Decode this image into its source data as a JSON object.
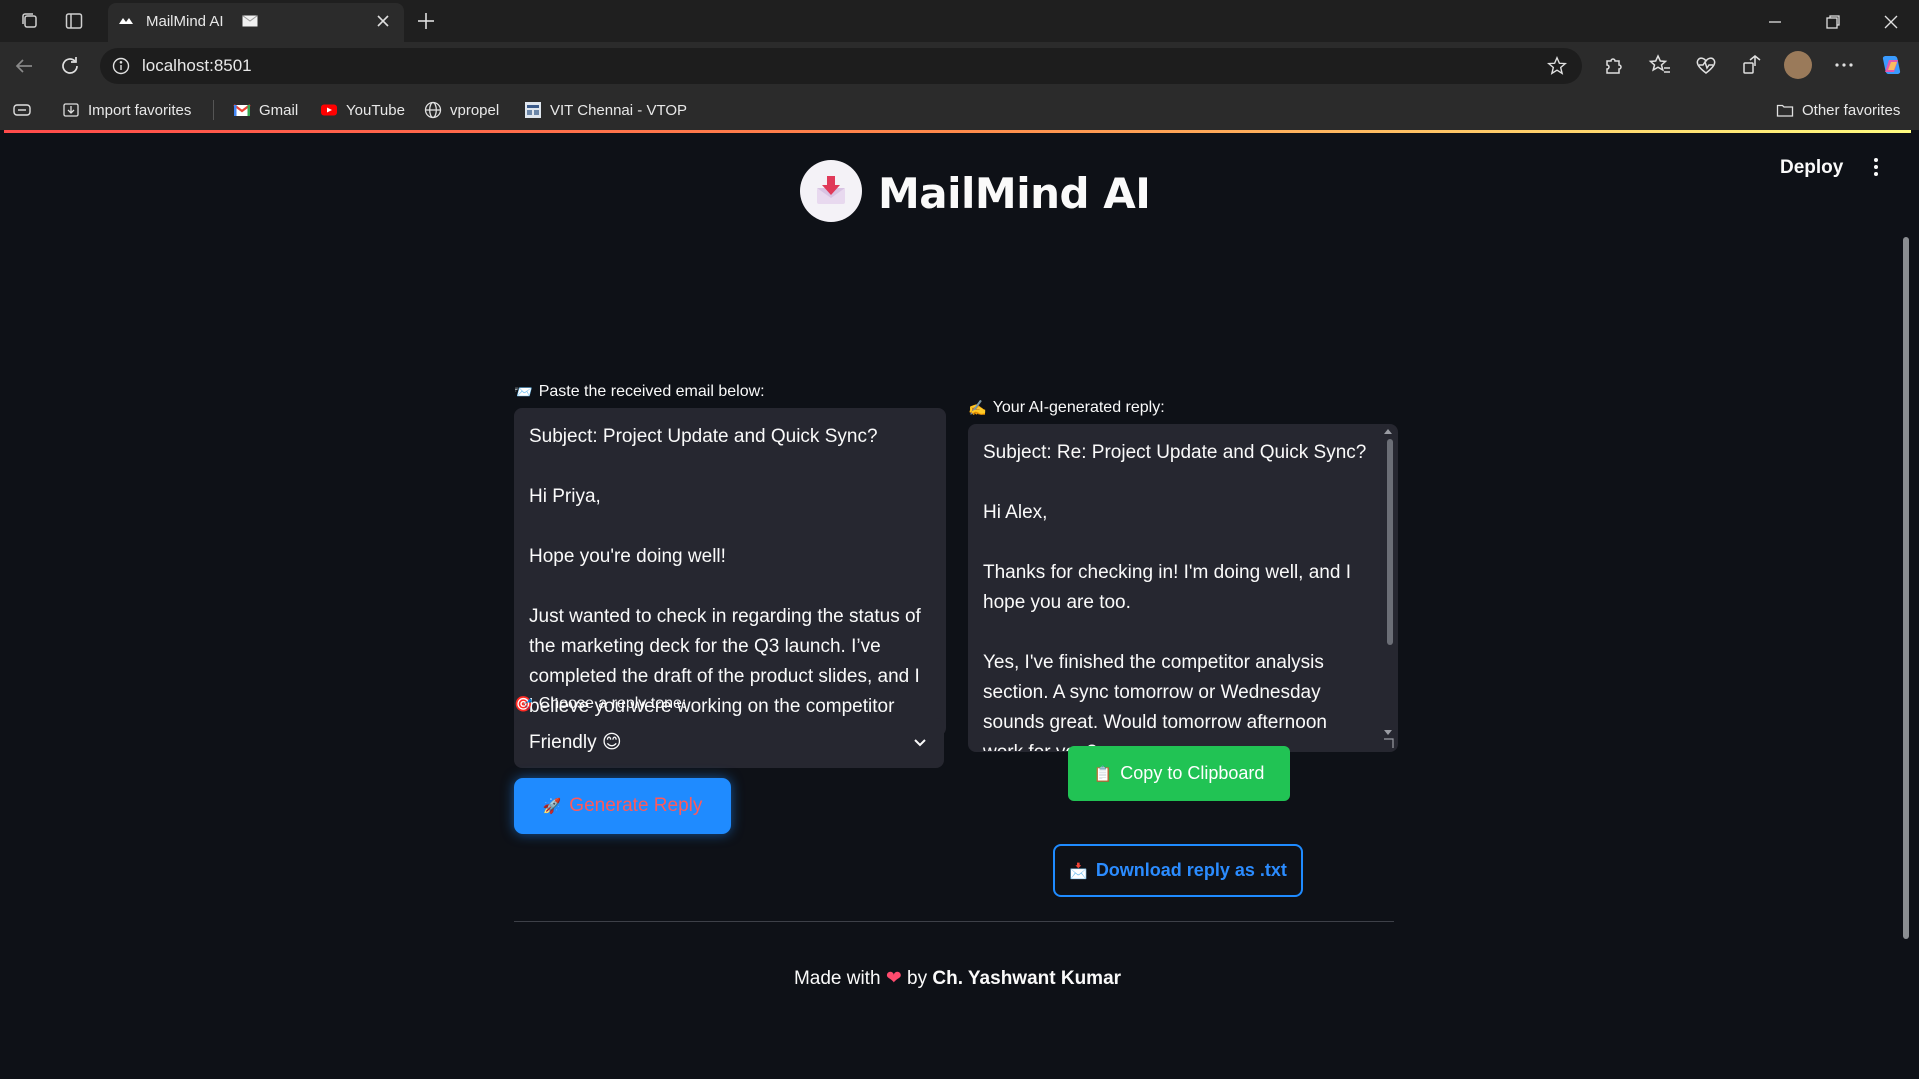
{
  "browser": {
    "tab_title": "MailMind AI",
    "url": "localhost:8501",
    "bookmarks": [
      {
        "label": "Import favorites",
        "icon": "import-icon"
      },
      {
        "label": "Gmail",
        "icon": "gmail-icon"
      },
      {
        "label": "YouTube",
        "icon": "youtube-icon"
      },
      {
        "label": "vpropel",
        "icon": "globe-icon"
      },
      {
        "label": "VIT Chennai - VTOP",
        "icon": "vtop-icon"
      }
    ],
    "other_favorites": "Other favorites"
  },
  "app": {
    "title": "MailMind AI",
    "deploy_label": "Deploy"
  },
  "input": {
    "icon": "📨",
    "label": "Paste the received email below:",
    "email_text": "Subject: Project Update and Quick Sync?\n\nHi Priya,\n\nHope you're doing well!\n\nJust wanted to check in regarding the status of the marketing deck for the Q3 launch. I’ve completed the draft of the product slides, and I believe you were working on the competitor analysis section?"
  },
  "tone": {
    "icon": "🎯",
    "label": "Choose a reply tone:",
    "selected": "Friendly 😊"
  },
  "generate": {
    "icon": "🚀",
    "label": "Generate Reply"
  },
  "output": {
    "icon": "✍️",
    "label": "Your AI-generated reply:",
    "reply_text": "Subject: Re: Project Update and Quick Sync?\n\nHi Alex,\n\nThanks for checking in! I'm doing well, and I hope you are too.\n\nYes, I've finished the competitor analysis section. A sync tomorrow or Wednesday sounds great. Would tomorrow afternoon work for you?"
  },
  "copy": {
    "icon": "📋",
    "label": "Copy to Clipboard"
  },
  "download": {
    "icon": "📩",
    "label": "Download reply as .txt"
  },
  "footer": {
    "prefix": "Made with",
    "heart": "❤",
    "by": "by",
    "author": "Ch. Yashwant Kumar"
  },
  "colors": {
    "background": "#0e1117",
    "field": "#262730",
    "primary_button": "#1f8bff",
    "copy_button": "#21c354",
    "accent_gradient": [
      "#ff4b4b",
      "#fffd80"
    ]
  }
}
